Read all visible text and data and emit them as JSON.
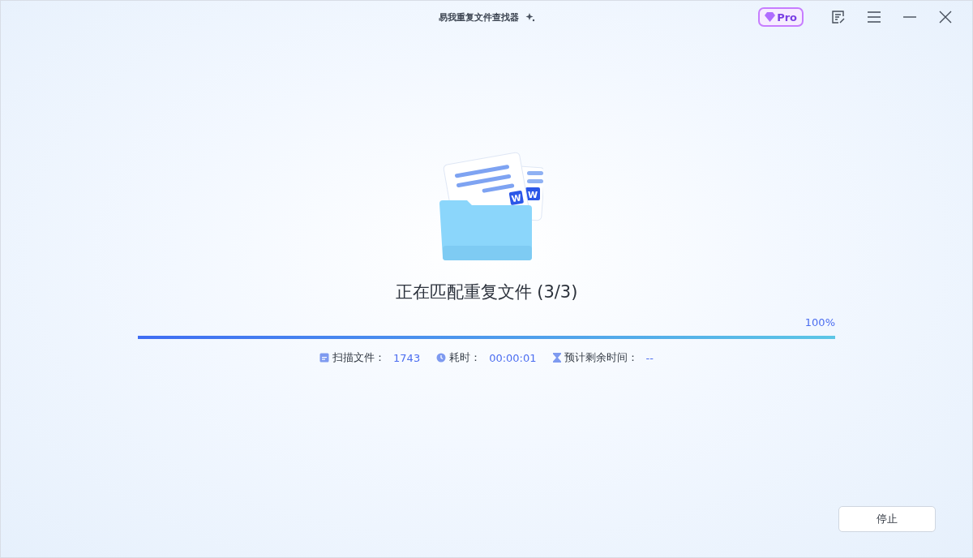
{
  "window": {
    "title": "易我重复文件查找器",
    "pro_badge": "Pro"
  },
  "illustration": {
    "file_badges": [
      "W",
      "W"
    ]
  },
  "status": {
    "title": "正在匹配重复文件 (3/3)",
    "percent": "100%",
    "level": 1
  },
  "stats": [
    {
      "kind": "files",
      "label": "扫描文件：",
      "value": "1743"
    },
    {
      "kind": "time",
      "label": "耗时：",
      "value": "00:00:01"
    },
    {
      "kind": "remaining",
      "label": "预计剩余时间：",
      "value": "--"
    }
  ],
  "buttons": {
    "stop": "停止"
  }
}
